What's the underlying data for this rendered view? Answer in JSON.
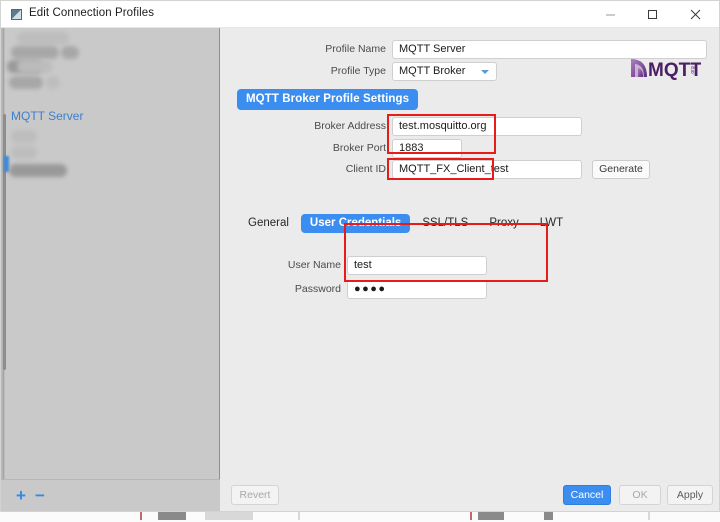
{
  "window": {
    "title": "Edit Connection Profiles",
    "icon": "app-icon",
    "controls": {
      "minimize": "minimize-icon",
      "maximize": "maximize-icon",
      "close": "close-icon"
    }
  },
  "sidebar": {
    "selected_item": "MQTT Server",
    "redacted_items": 8,
    "add_label": "+",
    "remove_label": "−"
  },
  "form": {
    "profile_name_label": "Profile Name",
    "profile_name_value": "MQTT Server",
    "profile_name_placeholder": "",
    "profile_type_label": "Profile Type",
    "profile_type_value": "MQTT Broker",
    "profile_type_options": [
      "MQTT Broker"
    ],
    "settings_badge": "MQTT Broker Profile Settings",
    "broker_address_label": "Broker Address",
    "broker_address_value": "test.mosquitto.org",
    "broker_port_label": "Broker Port",
    "broker_port_value": "1883",
    "client_id_label": "Client ID",
    "client_id_value": "MQTT_FX_Client_test",
    "generate_label": "Generate"
  },
  "logo": {
    "text": "MQTT",
    "suffix": ".org",
    "name": "mqtt-logo"
  },
  "tabs": [
    {
      "label": "General",
      "active": false
    },
    {
      "label": "User Credentials",
      "active": true
    },
    {
      "label": "SSL/TLS",
      "active": false
    },
    {
      "label": "Proxy",
      "active": false
    },
    {
      "label": "LWT",
      "active": false
    }
  ],
  "credentials": {
    "username_label": "User Name",
    "username_value": "test",
    "password_label": "Password",
    "password_value": "●●●●"
  },
  "footer": {
    "revert_label": "Revert",
    "cancel_label": "Cancel",
    "ok_label": "OK",
    "apply_label": "Apply"
  },
  "annotations": [
    {
      "name": "broker-address-port-highlight"
    },
    {
      "name": "client-id-highlight"
    },
    {
      "name": "user-credentials-highlight"
    }
  ],
  "colors": {
    "accent_blue": "#3b8ef0",
    "annotation_red": "#e81b1b",
    "sidebar_gray": "#c9c9c9",
    "panel_gray": "#ebebeb",
    "link_blue": "#3d7fd0"
  }
}
